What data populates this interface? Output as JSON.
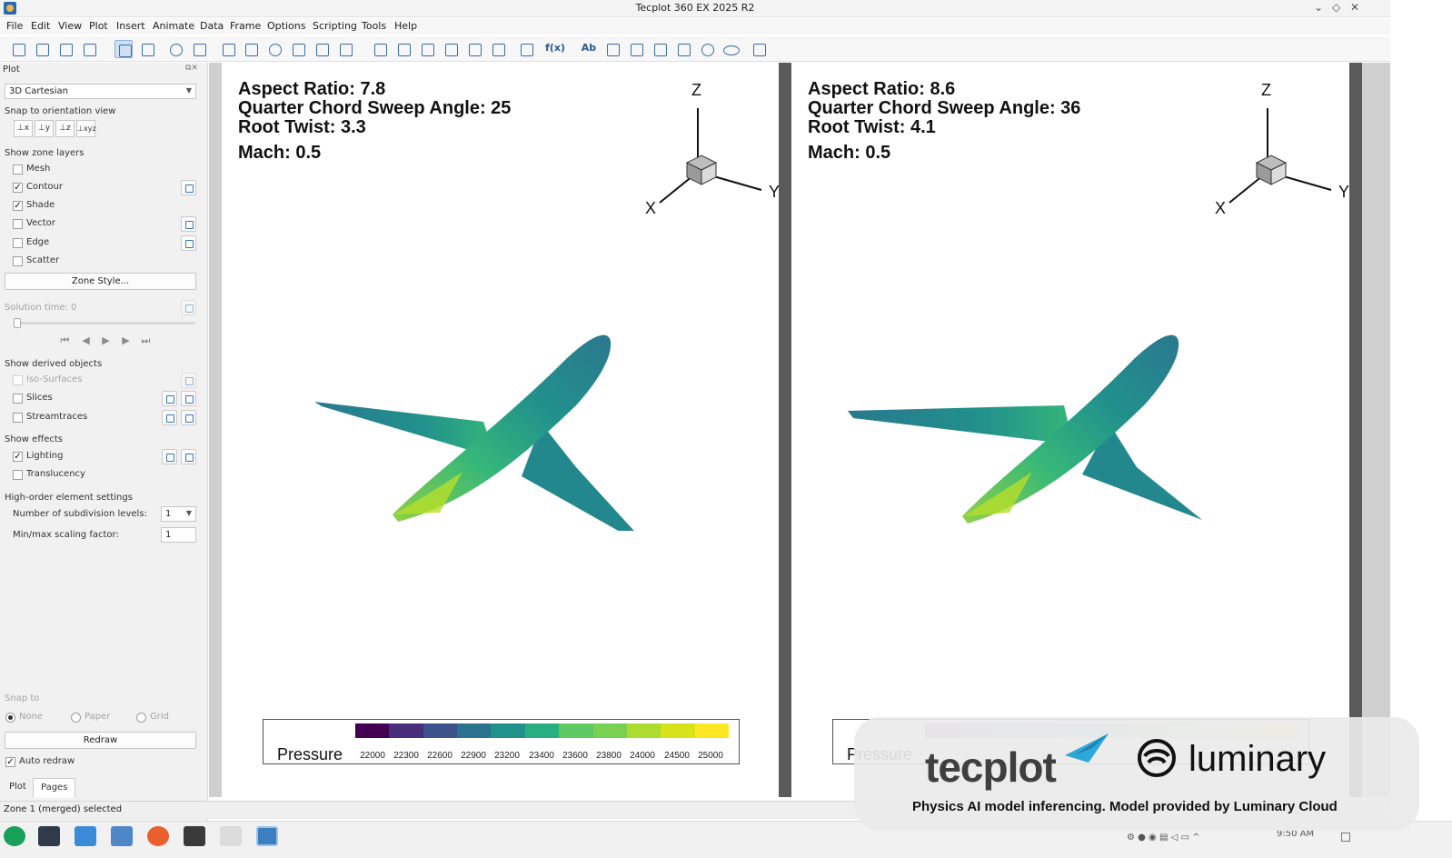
{
  "window": {
    "title": "Tecplot 360 EX 2025 R2",
    "controls": [
      "⌄",
      "◇",
      "✕"
    ]
  },
  "menu": [
    "File",
    "Edit",
    "View",
    "Plot",
    "Insert",
    "Animate",
    "Data",
    "Frame",
    "Options",
    "Scripting",
    "Tools",
    "Help"
  ],
  "toolbar": {
    "icons": [
      "new-icon",
      "open-icon",
      "save-icon",
      "print-icon",
      "select-icon",
      "adjustor-icon",
      "zoom-icon",
      "translate-icon",
      "rotate-spherical-icon",
      "rotate-rollerball-icon",
      "rotate-twist-icon",
      "probe-icon",
      "zoom-extent-icon",
      "cross-section-icon",
      "streamtrace-icon",
      "slice-icon",
      "isosurface-icon",
      "contour-edit-icon",
      "xy-edit-icon",
      "mesh-edit-icon",
      "data-edit-icon",
      "fx-icon",
      "text-icon",
      "image-icon",
      "polyline-icon",
      "rectangle-icon",
      "square-icon",
      "circle-icon",
      "ellipse-icon",
      "frame-icon"
    ],
    "fx_label": "f(x)",
    "text_label": "Ab"
  },
  "sidebar": {
    "header": "Plot",
    "plot_type": "3D Cartesian",
    "snap_orientation_label": "Snap to orientation view",
    "orientation_buttons": [
      "⊥x",
      "⊥y",
      "⊥z",
      "⊥xyz"
    ],
    "zone_layers_label": "Show zone layers",
    "layers": [
      {
        "label": "Mesh",
        "checked": false
      },
      {
        "label": "Contour",
        "checked": true
      },
      {
        "label": "Shade",
        "checked": true
      },
      {
        "label": "Vector",
        "checked": false
      },
      {
        "label": "Edge",
        "checked": false
      },
      {
        "label": "Scatter",
        "checked": false
      }
    ],
    "zone_style_button": "Zone Style...",
    "solution_time": "Solution time: 0",
    "derived_label": "Show derived objects",
    "derived": [
      {
        "label": "Iso-Surfaces",
        "checked": false
      },
      {
        "label": "Slices",
        "checked": false
      },
      {
        "label": "Streamtraces",
        "checked": false
      }
    ],
    "effects_label": "Show effects",
    "effects": [
      {
        "label": "Lighting",
        "checked": true
      },
      {
        "label": "Translucency",
        "checked": false
      }
    ],
    "high_order_label": "High-order element settings",
    "subdivision_label": "Number of subdivision levels:",
    "subdivision_value": "1",
    "scaling_label": "Min/max scaling factor:",
    "scaling_value": "1",
    "snap_to_label": "Snap to",
    "snap_options": [
      {
        "label": "None",
        "selected": true
      },
      {
        "label": "Paper",
        "selected": false
      },
      {
        "label": "Grid",
        "selected": false
      }
    ],
    "redraw_button": "Redraw",
    "auto_redraw_label": "Auto redraw",
    "auto_redraw_checked": true,
    "tabs": [
      "Plot",
      "Pages"
    ],
    "check_mark": "✓"
  },
  "frames": [
    {
      "aspect_ratio": "Aspect Ratio: 7.8",
      "sweep": "Quarter Chord Sweep Angle: 25",
      "twist": "Root Twist: 3.3",
      "mach": "Mach: 0.5"
    },
    {
      "aspect_ratio": "Aspect Ratio: 8.6",
      "sweep": "Quarter Chord Sweep Angle: 36",
      "twist": "Root Twist: 4.1",
      "mach": "Mach: 0.5"
    }
  ],
  "axes": {
    "x": "X",
    "y": "Y",
    "z": "Z"
  },
  "legend": {
    "title": "Pressure",
    "levels": [
      "22000",
      "22300",
      "22600",
      "22900",
      "23200",
      "23400",
      "23600",
      "23800",
      "24000",
      "24500",
      "25000"
    ],
    "colors": [
      "#440154",
      "#472d7b",
      "#3b528b",
      "#2c728e",
      "#21918c",
      "#28ae80",
      "#5ec962",
      "#7ad151",
      "#addc30",
      "#d8e219",
      "#fde725"
    ]
  },
  "status": "Zone 1 (merged) selected",
  "taskbar": {
    "apps": [
      "start-icon",
      "terminal-icon",
      "store-icon",
      "files-icon",
      "firefox-icon",
      "matlab-icon",
      "document-icon",
      "tecplot-icon"
    ],
    "time": "9:50 AM"
  },
  "branding": {
    "tecplot": "tecplot",
    "luminary": "luminary",
    "caption": "Physics AI model inferencing. Model provided by Luminary Cloud"
  }
}
